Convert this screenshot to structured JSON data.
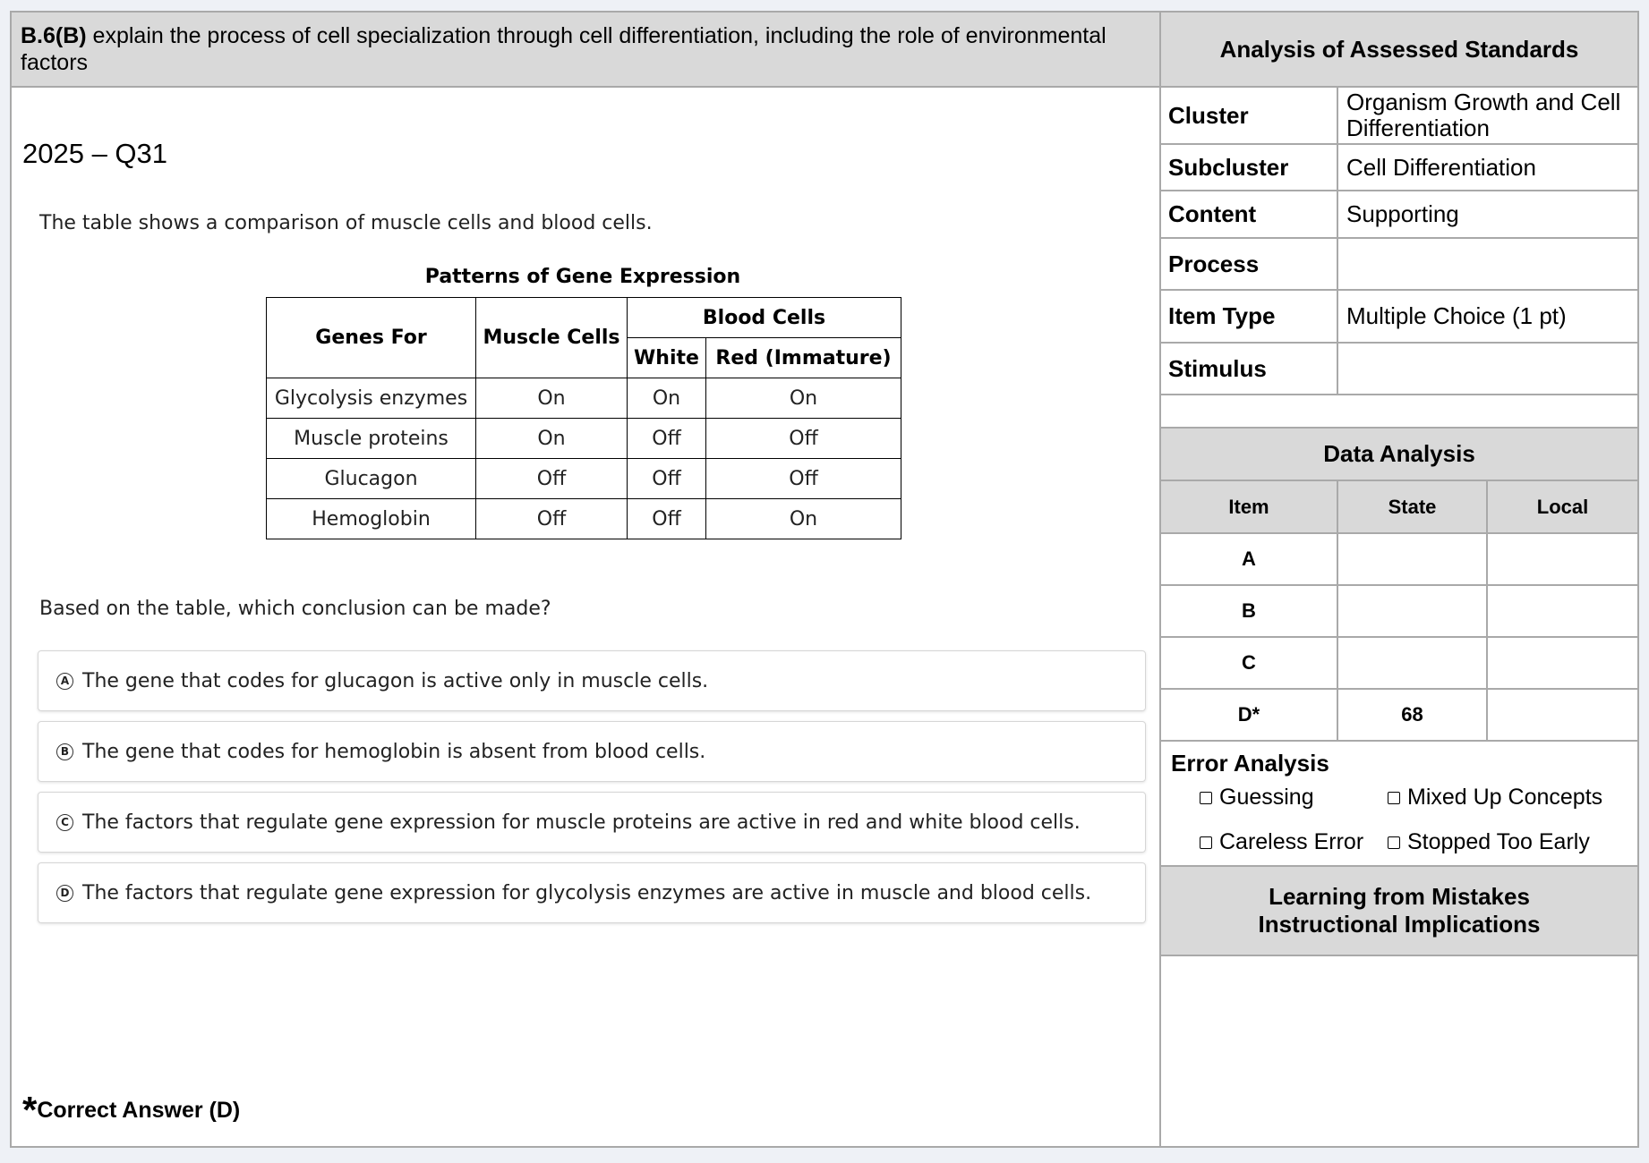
{
  "standard": {
    "code": "B.6(B)",
    "text": " explain the process of cell specialization through cell differentiation, including the role of environmental factors"
  },
  "question_id": "2025 – Q31",
  "stem": "The table shows a comparison of muscle cells and blood cells.",
  "gene_table": {
    "title": "Patterns of Gene Expression",
    "headers": {
      "genes_for": "Genes For",
      "muscle_cells": "Muscle Cells",
      "blood_cells": "Blood Cells",
      "white": "White",
      "red": "Red (Immature)"
    },
    "rows": [
      {
        "gene": "Glycolysis enzymes",
        "muscle": "On",
        "white": "On",
        "red": "On"
      },
      {
        "gene": "Muscle proteins",
        "muscle": "On",
        "white": "Off",
        "red": "Off"
      },
      {
        "gene": "Glucagon",
        "muscle": "Off",
        "white": "Off",
        "red": "Off"
      },
      {
        "gene": "Hemoglobin",
        "muscle": "Off",
        "white": "Off",
        "red": "On"
      }
    ]
  },
  "prompt": "Based on the table, which conclusion can be made?",
  "choices": [
    {
      "letter": "A",
      "text": "The gene that codes for glucagon is active only in muscle cells."
    },
    {
      "letter": "B",
      "text": "The gene that codes for hemoglobin is absent from blood cells."
    },
    {
      "letter": "C",
      "text": "The factors that regulate gene expression for muscle proteins are active in red and white blood cells."
    },
    {
      "letter": "D",
      "text": "The factors that regulate gene expression for glycolysis enzymes are active in muscle and blood cells."
    }
  ],
  "correct_answer": {
    "star": "*",
    "text": "Correct Answer (D)"
  },
  "analysis": {
    "title": "Analysis of Assessed Standards",
    "rows": [
      {
        "key": "Cluster",
        "value": "Organism Growth and Cell Differentiation"
      },
      {
        "key": "Subcluster",
        "value": "Cell Differentiation"
      },
      {
        "key": "Content",
        "value": "Supporting"
      },
      {
        "key": "Process",
        "value": ""
      },
      {
        "key": "Item Type",
        "value": "Multiple Choice (1 pt)"
      },
      {
        "key": "Stimulus",
        "value": ""
      }
    ]
  },
  "data_analysis": {
    "title": "Data Analysis",
    "headers": {
      "item": "Item",
      "state": "State",
      "local": "Local"
    },
    "rows": [
      {
        "item": "A",
        "state": "",
        "local": ""
      },
      {
        "item": "B",
        "state": "",
        "local": ""
      },
      {
        "item": "C",
        "state": "",
        "local": ""
      },
      {
        "item": "D*",
        "state": "68",
        "local": ""
      }
    ]
  },
  "error_analysis": {
    "title": "Error Analysis",
    "options": [
      "Guessing",
      "Mixed Up Concepts",
      "Careless Error",
      "Stopped Too Early"
    ]
  },
  "learning": {
    "line1": "Learning from Mistakes",
    "line2": "Instructional Implications"
  }
}
